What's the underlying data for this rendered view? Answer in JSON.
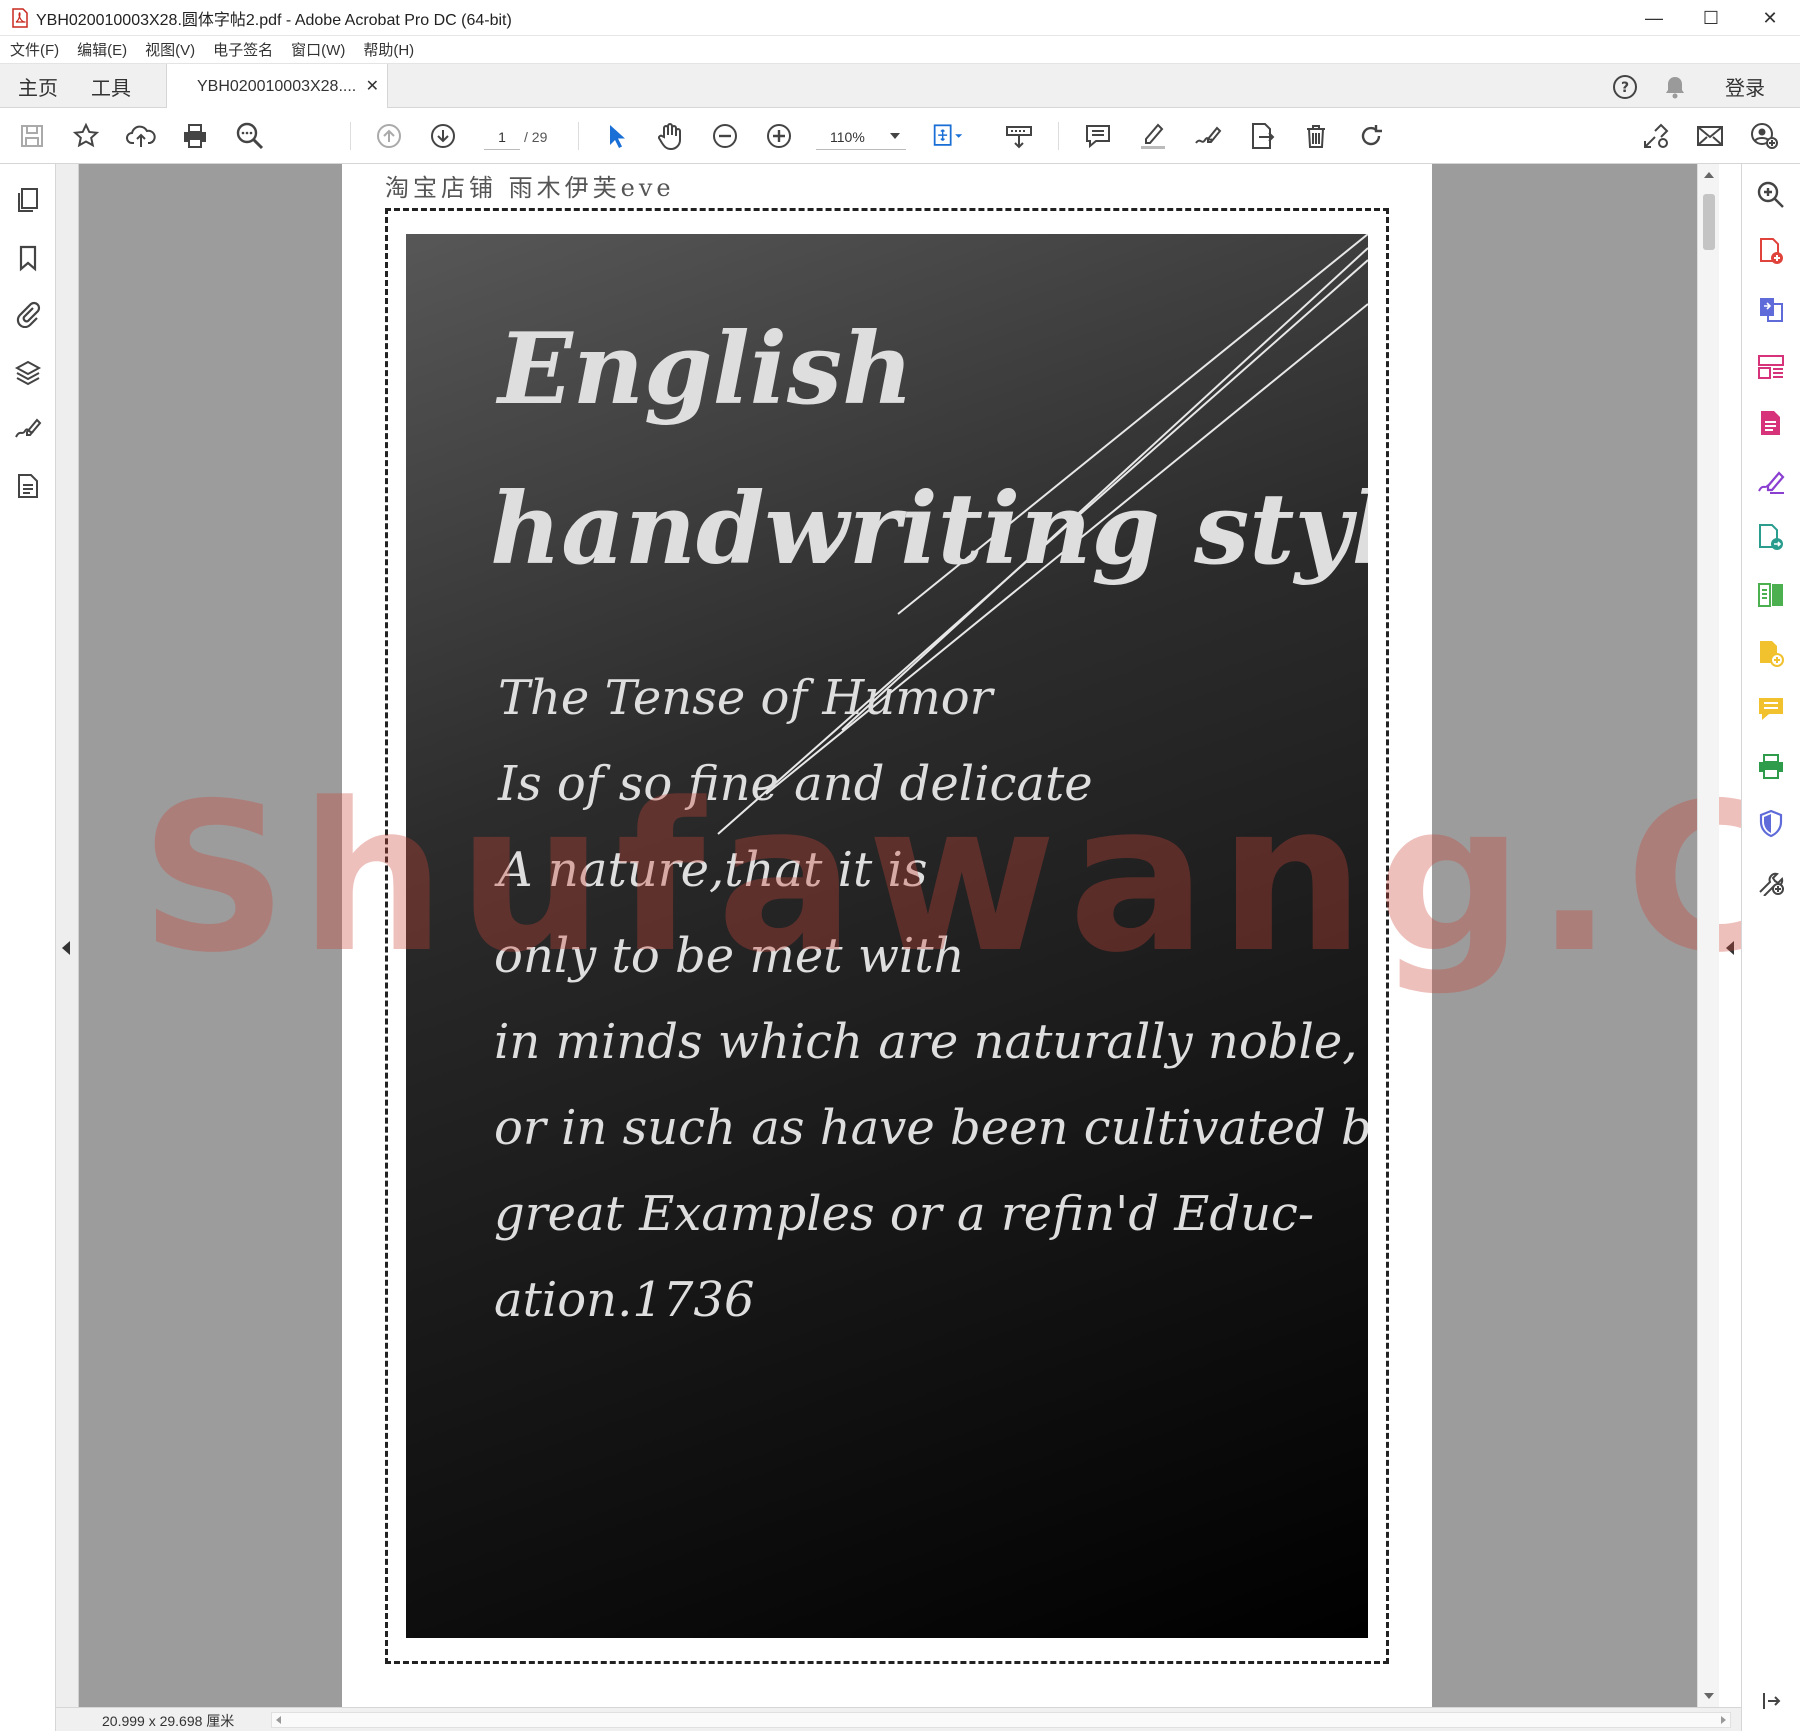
{
  "window": {
    "title": "YBH020010003X28.圆体字帖2.pdf - Adobe Acrobat Pro DC (64-bit)",
    "controls": {
      "minimize": "—",
      "maximize": "☐",
      "close": "✕"
    }
  },
  "menu": [
    "文件(F)",
    "编辑(E)",
    "视图(V)",
    "电子签名",
    "窗口(W)",
    "帮助(H)"
  ],
  "tabs": {
    "home": "主页",
    "tools": "工具",
    "document": "YBH020010003X28....",
    "close": "✕",
    "login": "登录"
  },
  "toolbar": {
    "page_current": "1",
    "page_total": "/ 29",
    "zoom": "110%"
  },
  "document": {
    "shop_line": "淘宝店铺 雨木伊芙eve",
    "heading_line1": "English",
    "heading_line2": "handwriting style",
    "poem": [
      "The Tense of Humor",
      "Is of so fine and delicate",
      "A nature,that it is",
      "only to be met with",
      "in minds which are naturally noble,",
      "or in such as have been cultivated by",
      "great Examples or a refin'd Educ-",
      "ation.1736"
    ],
    "watermark": "Shufawang.CN"
  },
  "status": {
    "page_dimensions": "20.999 x 29.698 厘米"
  },
  "colors": {
    "accent_blue": "#1a6fd6",
    "watermark": "#cd463c",
    "doc_background": "#9c9c9c",
    "board_top": "#575757",
    "board_bottom": "#000000"
  }
}
